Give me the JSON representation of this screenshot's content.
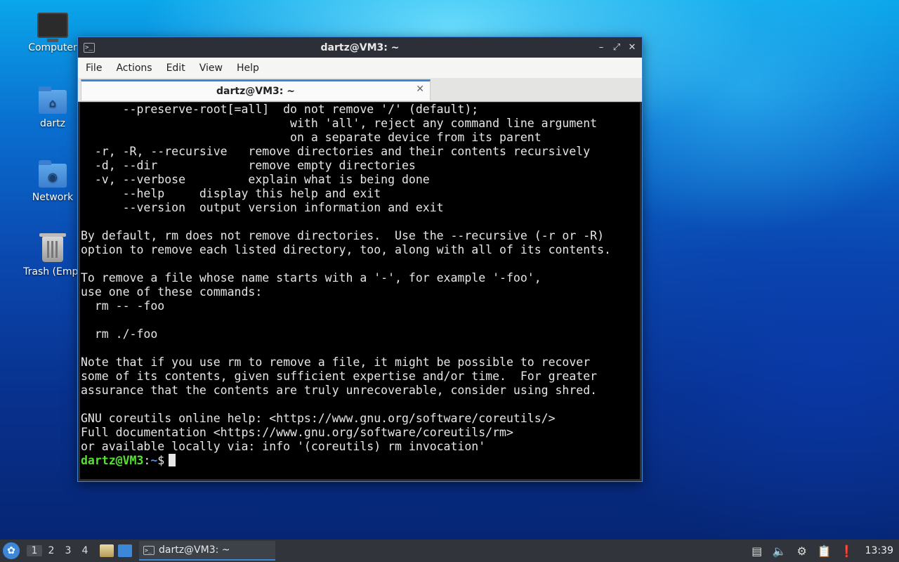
{
  "desktop": {
    "icons": [
      {
        "label": "Computer",
        "icon": "computer-icon"
      },
      {
        "label": "dartz",
        "icon": "home-folder-icon"
      },
      {
        "label": "Network",
        "icon": "network-folder-icon"
      },
      {
        "label": "Trash (Empt",
        "icon": "trash-icon"
      }
    ]
  },
  "window": {
    "title": "dartz@VM3: ~",
    "buttons": {
      "minimize": "–",
      "maximize": "⤢",
      "close": "✕"
    },
    "menu": [
      "File",
      "Actions",
      "Edit",
      "View",
      "Help"
    ],
    "tab": {
      "label": "dartz@VM3: ~",
      "close": "✕"
    }
  },
  "terminal": {
    "lines": [
      "      --preserve-root[=all]  do not remove '/' (default);",
      "                              with 'all', reject any command line argument",
      "                              on a separate device from its parent",
      "  -r, -R, --recursive   remove directories and their contents recursively",
      "  -d, --dir             remove empty directories",
      "  -v, --verbose         explain what is being done",
      "      --help     display this help and exit",
      "      --version  output version information and exit",
      "",
      "By default, rm does not remove directories.  Use the --recursive (-r or -R)",
      "option to remove each listed directory, too, along with all of its contents.",
      "",
      "To remove a file whose name starts with a '-', for example '-foo',",
      "use one of these commands:",
      "  rm -- -foo",
      "",
      "  rm ./-foo",
      "",
      "Note that if you use rm to remove a file, it might be possible to recover",
      "some of its contents, given sufficient expertise and/or time.  For greater",
      "assurance that the contents are truly unrecoverable, consider using shred.",
      "",
      "GNU coreutils online help: <https://www.gnu.org/software/coreutils/>",
      "Full documentation <https://www.gnu.org/software/coreutils/rm>",
      "or available locally via: info '(coreutils) rm invocation'"
    ],
    "prompt": {
      "user_host": "dartz@VM3",
      "sep": ":",
      "path": "~",
      "symbol": "$"
    }
  },
  "taskbar": {
    "start_icon": "lxqt-menu-icon",
    "workspaces": [
      "1",
      "2",
      "3",
      "4"
    ],
    "active_workspace": "1",
    "task_label": "dartz@VM3: ~",
    "clock": "13:39",
    "tray_icons": [
      "keyboard-icon",
      "volume-icon",
      "network-icon",
      "clipboard-icon",
      "update-icon"
    ]
  }
}
